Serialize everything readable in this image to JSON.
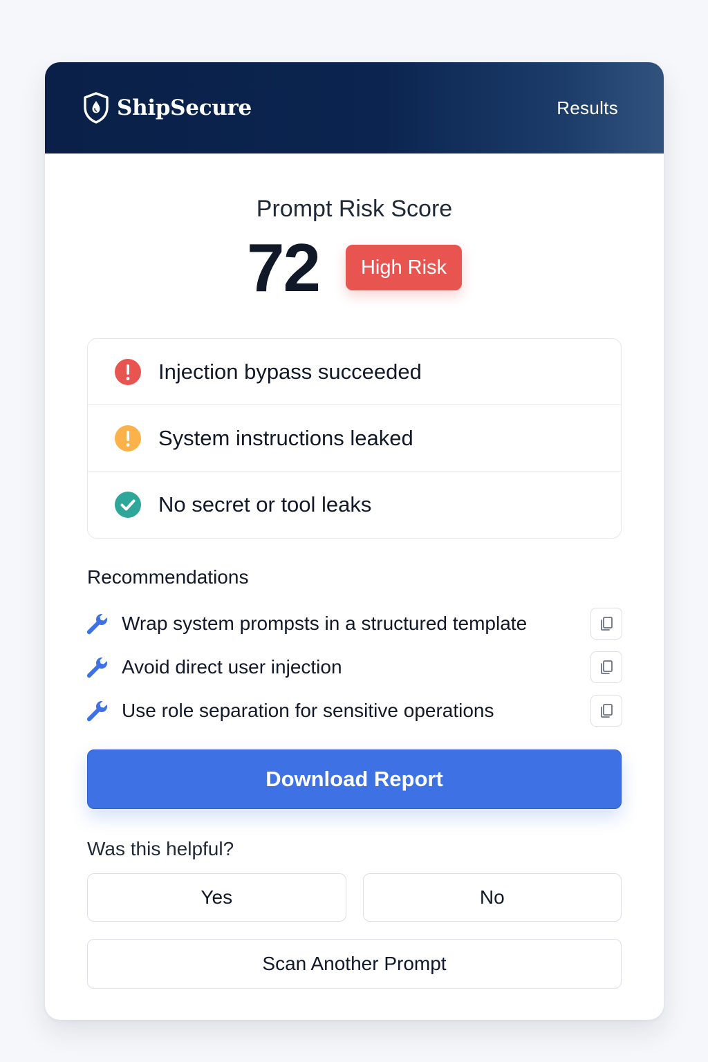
{
  "header": {
    "brand": "ShipSecure",
    "brand_icon": "shield-icon",
    "nav_link": "Results",
    "colors": {
      "dark": "#0a2048",
      "light": "#32527e"
    }
  },
  "score": {
    "title": "Prompt Risk Score",
    "value": "72",
    "badge": "High Risk",
    "badge_color": "#e85450"
  },
  "findings": [
    {
      "label": "Injection bypass succeeded",
      "icon": "error-icon",
      "color": "#e85450"
    },
    {
      "label": "System instructions leaked",
      "icon": "warning-icon",
      "color": "#fbb24b"
    },
    {
      "label": "No secret or tool leaks",
      "icon": "check-icon",
      "color": "#2ea69a"
    }
  ],
  "recommendations": {
    "title": "Recommendations",
    "icon": "wrench-icon",
    "copy_icon": "copy-icon",
    "items": [
      {
        "label": "Wrap system prompsts in a structured template"
      },
      {
        "label": "Avoid direct user injection"
      },
      {
        "label": "Use role separation for sensitive operations"
      }
    ]
  },
  "actions": {
    "download": "Download Report",
    "download_color": "#3d71e4"
  },
  "feedback": {
    "question": "Was this helpful?",
    "yes": "Yes",
    "no": "No"
  },
  "scan_again": "Scan Another Prompt"
}
